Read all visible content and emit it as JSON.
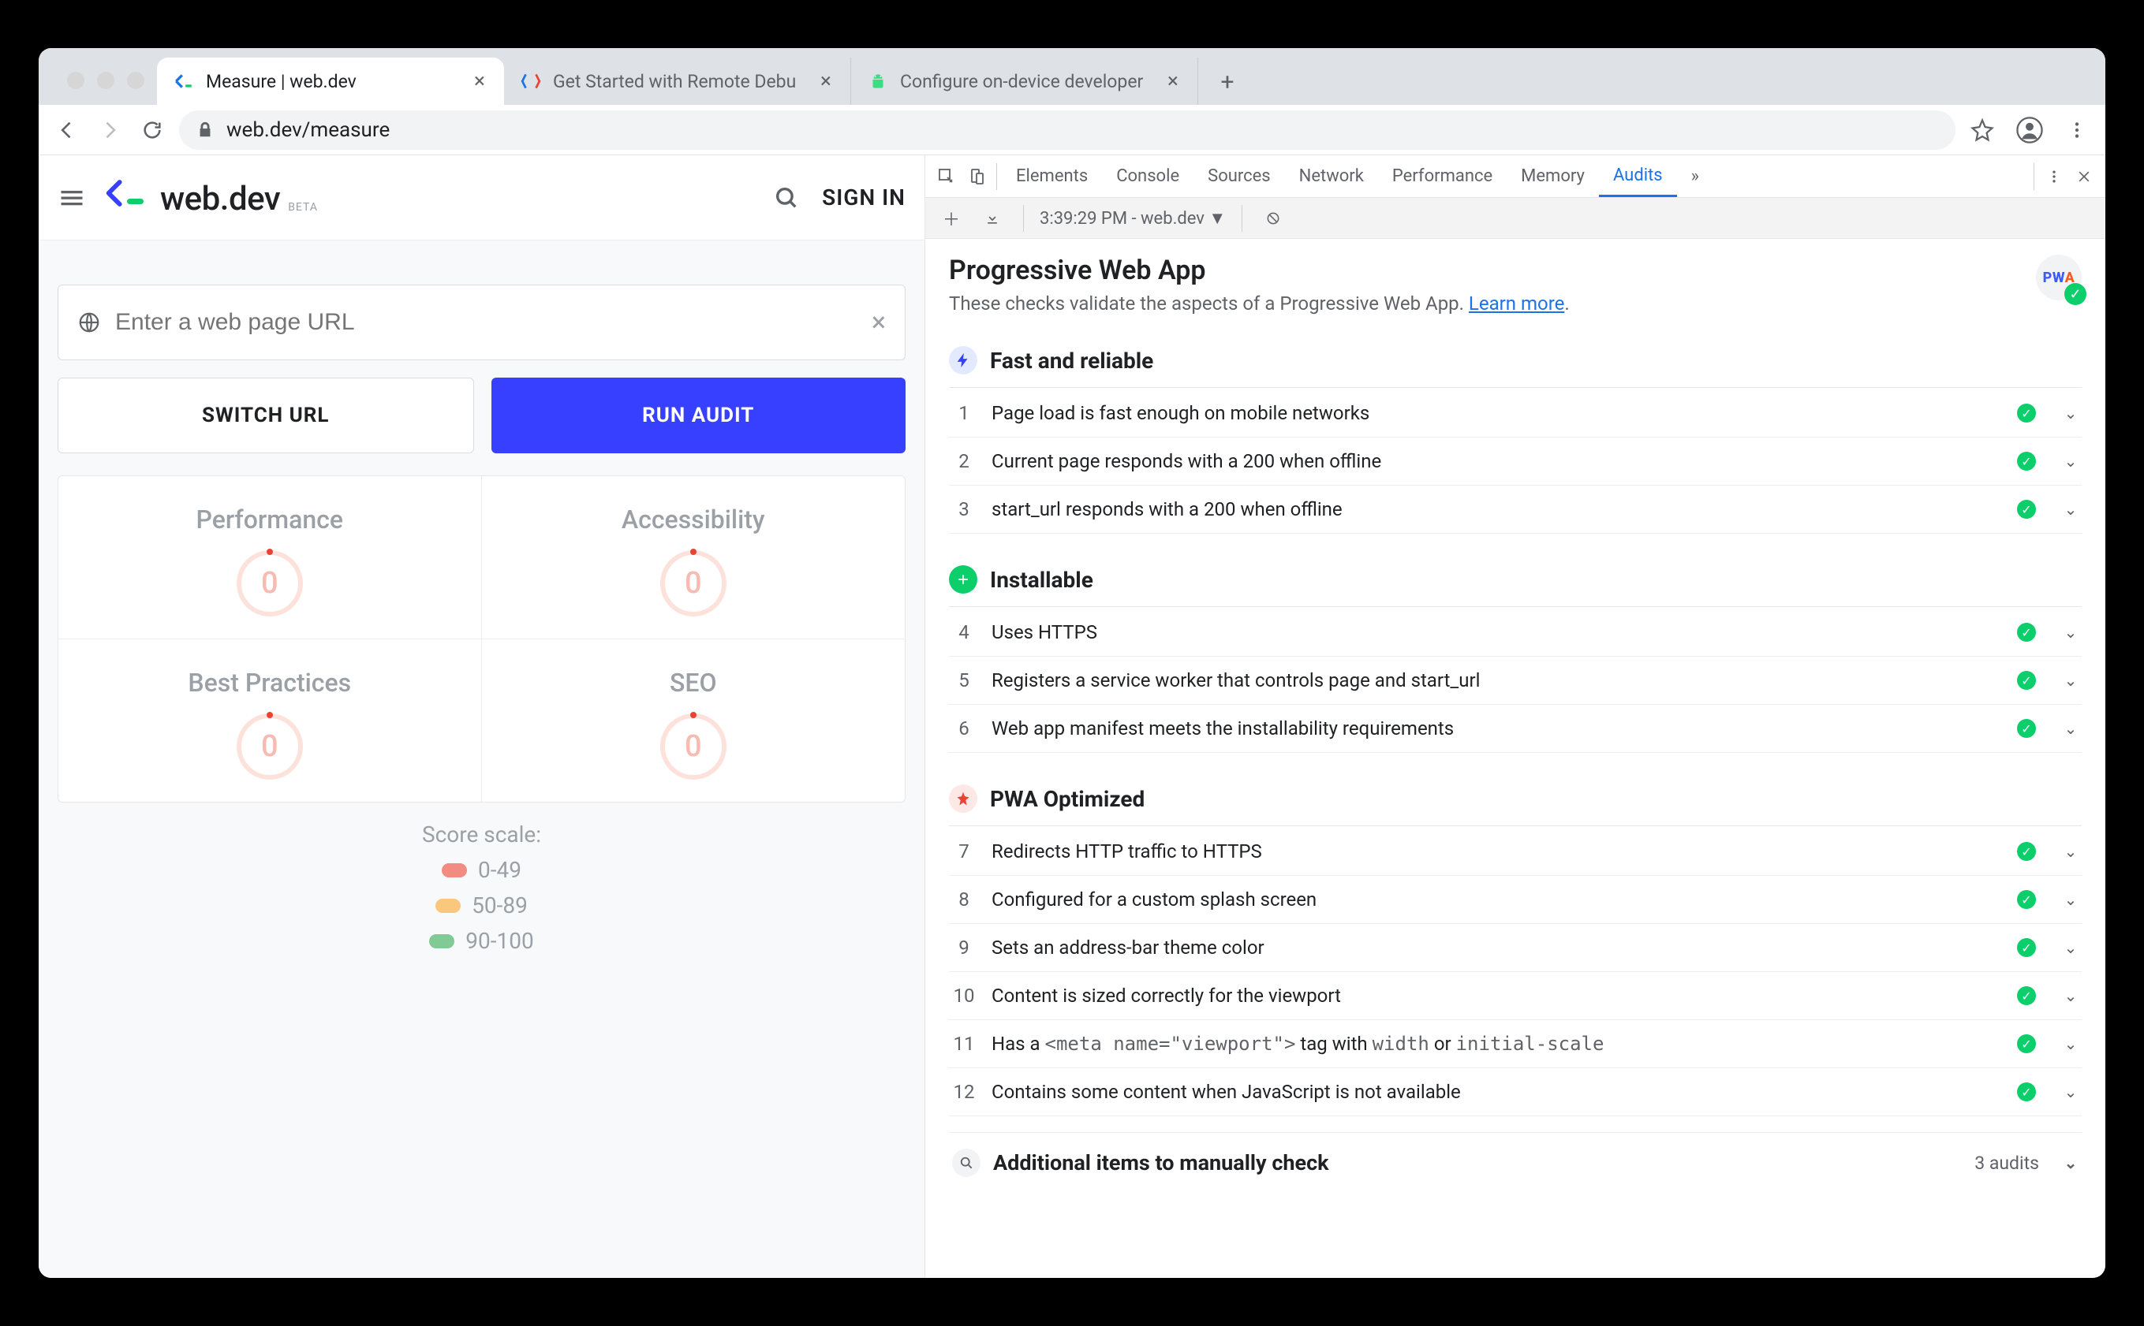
{
  "browser": {
    "tabs": [
      {
        "title": "Measure  |  web.dev"
      },
      {
        "title": "Get Started with Remote Debu"
      },
      {
        "title": "Configure on-device developer"
      }
    ],
    "url": "web.dev/measure"
  },
  "page": {
    "logo_text": "web.dev",
    "logo_beta": "BETA",
    "sign_in": "SIGN IN",
    "url_placeholder": "Enter a web page URL",
    "switch_url": "SWITCH URL",
    "run_audit": "RUN AUDIT",
    "scores": [
      {
        "label": "Performance",
        "value": "0"
      },
      {
        "label": "Accessibility",
        "value": "0"
      },
      {
        "label": "Best Practices",
        "value": "0"
      },
      {
        "label": "SEO",
        "value": "0"
      }
    ],
    "score_scale_label": "Score scale:",
    "scale": [
      {
        "color": "red",
        "range": "0-49"
      },
      {
        "color": "orange",
        "range": "50-89"
      },
      {
        "color": "green",
        "range": "90-100"
      }
    ]
  },
  "devtools": {
    "tabs": [
      "Elements",
      "Console",
      "Sources",
      "Network",
      "Performance",
      "Memory",
      "Audits"
    ],
    "active_tab": "Audits",
    "runinfo": "3:39:29 PM - web.dev",
    "title": "Progressive Web App",
    "subtitle_prefix": "These checks validate the aspects of a Progressive Web App. ",
    "learn_more": "Learn more",
    "sections": [
      {
        "title": "Fast and reliable",
        "icon": "bolt",
        "items": [
          {
            "n": "1",
            "text": "Page load is fast enough on mobile networks"
          },
          {
            "n": "2",
            "text": "Current page responds with a 200 when offline"
          },
          {
            "n": "3",
            "text": "start_url responds with a 200 when offline"
          }
        ]
      },
      {
        "title": "Installable",
        "icon": "plus",
        "items": [
          {
            "n": "4",
            "text": "Uses HTTPS"
          },
          {
            "n": "5",
            "text": "Registers a service worker that controls page and start_url"
          },
          {
            "n": "6",
            "text": "Web app manifest meets the installability requirements"
          }
        ]
      },
      {
        "title": "PWA Optimized",
        "icon": "star",
        "items": [
          {
            "n": "7",
            "text": "Redirects HTTP traffic to HTTPS"
          },
          {
            "n": "8",
            "text": "Configured for a custom splash screen"
          },
          {
            "n": "9",
            "text": "Sets an address-bar theme color"
          },
          {
            "n": "10",
            "text": "Content is sized correctly for the viewport"
          },
          {
            "n": "11",
            "html": "Has a <code>&lt;meta name=\"viewport\"&gt;</code> tag with <code>width</code> or <code>initial-scale</code>"
          },
          {
            "n": "12",
            "text": "Contains some content when JavaScript is not available"
          }
        ]
      }
    ],
    "manual_title": "Additional items to manually check",
    "manual_count": "3 audits"
  }
}
